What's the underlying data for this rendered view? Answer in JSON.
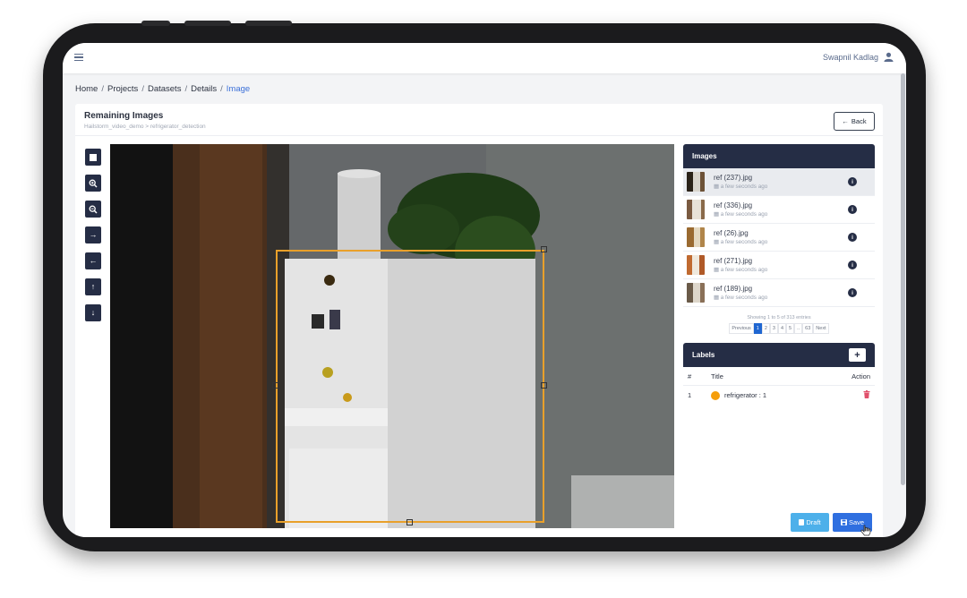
{
  "header": {
    "user_name": "Swapnil Kadlag"
  },
  "breadcrumb": {
    "items": [
      "Home",
      "Projects",
      "Datasets",
      "Details"
    ],
    "active": "Image",
    "separator": "/"
  },
  "card": {
    "title": "Remaining Images",
    "subtitle": "Hailstorm_video_demo > refrigerator_detection",
    "back_label": "Back"
  },
  "tools": {
    "icons": [
      "square-tool-icon",
      "zoom-in-icon",
      "zoom-out-icon",
      "arrow-right-icon",
      "arrow-left-icon",
      "arrow-up-icon",
      "arrow-down-icon"
    ]
  },
  "images_panel": {
    "title": "Images",
    "items": [
      {
        "name": "ref (237).jpg",
        "time": "a few seconds ago"
      },
      {
        "name": "ref (336).jpg",
        "time": "a few seconds ago"
      },
      {
        "name": "ref (26).jpg",
        "time": "a few seconds ago"
      },
      {
        "name": "ref (271).jpg",
        "time": "a few seconds ago"
      },
      {
        "name": "ref (189).jpg",
        "time": "a few seconds ago"
      }
    ],
    "showing": "Showing 1 to 5 of 313 entries",
    "pager": [
      "Previous",
      "1",
      "2",
      "3",
      "4",
      "5",
      "..",
      "63",
      "Next"
    ],
    "current_page": "1"
  },
  "labels_panel": {
    "title": "Labels",
    "add_label": "+",
    "columns": [
      "#",
      "Title",
      "Action"
    ],
    "rows": [
      {
        "num": "1",
        "title": "refrigerator : 1",
        "color": "#f59e0b"
      }
    ]
  },
  "actions": {
    "draft_label": "Draft",
    "save_label": "Save"
  },
  "colors": {
    "accent": "#3b6fd8",
    "panel_header": "#252d45",
    "bbox": "#e9a02a"
  }
}
